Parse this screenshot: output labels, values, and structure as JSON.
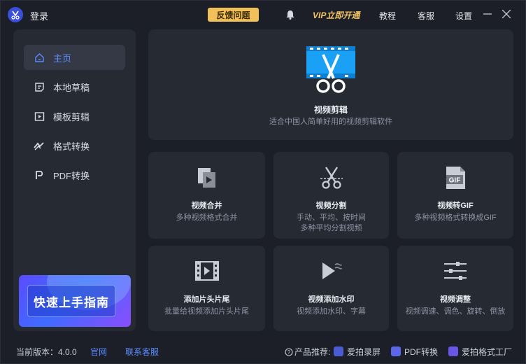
{
  "titlebar": {
    "login": "登录",
    "feedback": "反馈问题",
    "vip": "VIP立即开通",
    "menu": [
      "教程",
      "客服",
      "设置"
    ]
  },
  "sidebar": {
    "items": [
      {
        "label": "主页",
        "icon": "home-icon",
        "active": true
      },
      {
        "label": "本地草稿",
        "icon": "draft-icon",
        "active": false
      },
      {
        "label": "模板剪辑",
        "icon": "template-icon",
        "active": false
      },
      {
        "label": "格式转换",
        "icon": "convert-icon",
        "active": false
      },
      {
        "label": "PDF转换",
        "icon": "pdf-icon",
        "active": false
      }
    ],
    "guide": "快速上手指南"
  },
  "hero": {
    "title": "视频剪辑",
    "subtitle": "适合中国人简单好用的视频剪辑软件"
  },
  "tools": [
    {
      "title": "视频合并",
      "subtitle": [
        "多种视频格式合并"
      ]
    },
    {
      "title": "视频分割",
      "subtitle": [
        "手动、平均、按时间",
        "多种平均分割视频"
      ]
    },
    {
      "title": "视频转GIF",
      "subtitle": [
        "多种视频格式转换成GIF"
      ],
      "badge": "GIF"
    },
    {
      "title": "添加片头片尾",
      "subtitle": [
        "批量给视频添加片头片尾"
      ]
    },
    {
      "title": "视频添加水印",
      "subtitle": [
        "视频添加水印、字幕"
      ]
    },
    {
      "title": "视频调整",
      "subtitle": [
        "视频调速、调色、旋转、倒放"
      ]
    }
  ],
  "footer": {
    "version_label": "当前版本：4.0.0",
    "official": "官网",
    "contact": "联系客服",
    "recommend": "产品推荐:",
    "products": [
      "爱拍录屏",
      "PDF转换",
      "爱拍格式工厂"
    ]
  },
  "colors": {
    "accent": "#5b8cff",
    "vip": "#f4c566",
    "feedback": "#f2c05a",
    "hero_icon": "#1aa0f5"
  }
}
